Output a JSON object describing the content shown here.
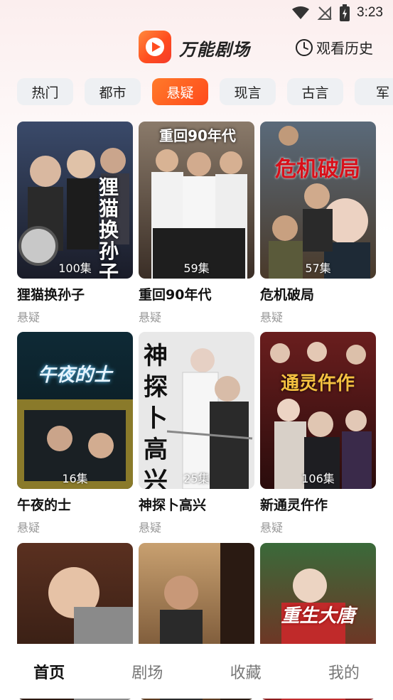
{
  "status_bar": {
    "time": "3:23"
  },
  "header": {
    "app_title": "万能剧场",
    "history_label": "观看历史"
  },
  "tabs": [
    {
      "label": "热门",
      "active": false
    },
    {
      "label": "都市",
      "active": false
    },
    {
      "label": "悬疑",
      "active": true
    },
    {
      "label": "现言",
      "active": false
    },
    {
      "label": "古言",
      "active": false
    },
    {
      "label": "军",
      "active": false
    }
  ],
  "dramas": [
    {
      "title": "狸猫换孙子",
      "genre": "悬疑",
      "episodes": "100集",
      "poster_text": "狸猫换孙子"
    },
    {
      "title": "重回90年代",
      "genre": "悬疑",
      "episodes": "59集",
      "poster_text": "重回90年代"
    },
    {
      "title": "危机破局",
      "genre": "悬疑",
      "episodes": "57集",
      "poster_text": "危机破局"
    },
    {
      "title": "午夜的士",
      "genre": "悬疑",
      "episodes": "16集",
      "poster_text": "午夜的士"
    },
    {
      "title": "神探卜高兴",
      "genre": "悬疑",
      "episodes": "25集",
      "poster_text": "神探卜高兴"
    },
    {
      "title": "新通灵仵作",
      "genre": "悬疑",
      "episodes": "106集",
      "poster_text": "通灵仵作"
    },
    {
      "poster_text": ""
    },
    {
      "poster_text": ""
    },
    {
      "poster_text": "重生大唐"
    }
  ],
  "bottom_nav": [
    {
      "label": "首页",
      "active": true
    },
    {
      "label": "剧场",
      "active": false
    },
    {
      "label": "收藏",
      "active": false
    },
    {
      "label": "我的",
      "active": false
    }
  ],
  "colors": {
    "accent": "#ff5a1f",
    "inactive_tab": "#eef0f3",
    "genre_text": "#999999"
  }
}
